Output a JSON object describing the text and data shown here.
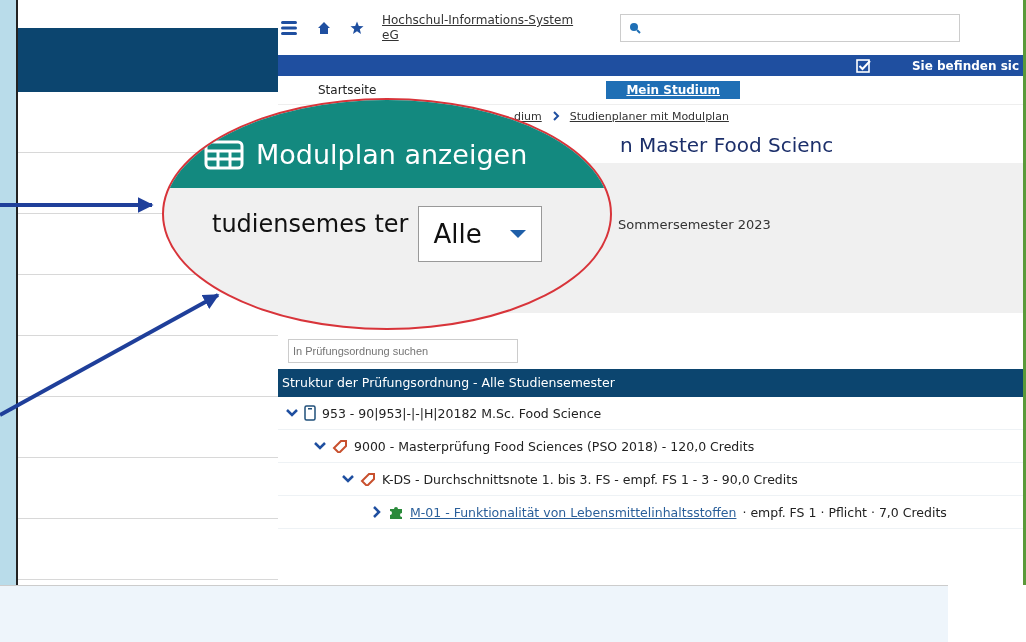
{
  "header": {
    "logo_text": "Hochschul-Informations-System eG",
    "location_text": "Sie befinden sic"
  },
  "nav_tabs": [
    {
      "label": "Startseite",
      "selected": false
    },
    {
      "label": "Mein Studium",
      "selected": true
    }
  ],
  "breadcrumb": [
    "dium",
    "Studienplaner mit Modulplan"
  ],
  "page_title": "n Master Food Scienc",
  "semester_value": "Sommersemester 2023",
  "search": {
    "placeholder": "In Prüfungsordnung suchen"
  },
  "tree_header": "Struktur der Prüfungsordnung - Alle Studiensemester",
  "tree": [
    {
      "kind": "degree",
      "label": "953 - 90|953|-|-|H|20182 M.Sc. Food Science",
      "expanded": true,
      "children": [
        {
          "kind": "exam",
          "label": "9000 - Masterprüfung Food Sciences (PSO 2018) - 120,0 Credits",
          "expanded": true,
          "children": [
            {
              "kind": "exam",
              "label": "K-DS - Durchschnittsnote 1. bis 3. FS - empf. FS 1 - 3 - 90,0 Credits",
              "expanded": true,
              "children": [
                {
                  "kind": "module",
                  "link": "M-01 - Funktionalität von Lebensmittelinhaltsstoffen",
                  "label": "· empf. FS 1 · Pflicht · 7,0 Credits",
                  "expanded": false
                }
              ]
            }
          ]
        }
      ]
    }
  ],
  "magnifier": {
    "title": "Modulplan anzeigen",
    "label_parts": [
      "tudiensemes",
      "ter"
    ],
    "dropdown_value": "Alle"
  }
}
